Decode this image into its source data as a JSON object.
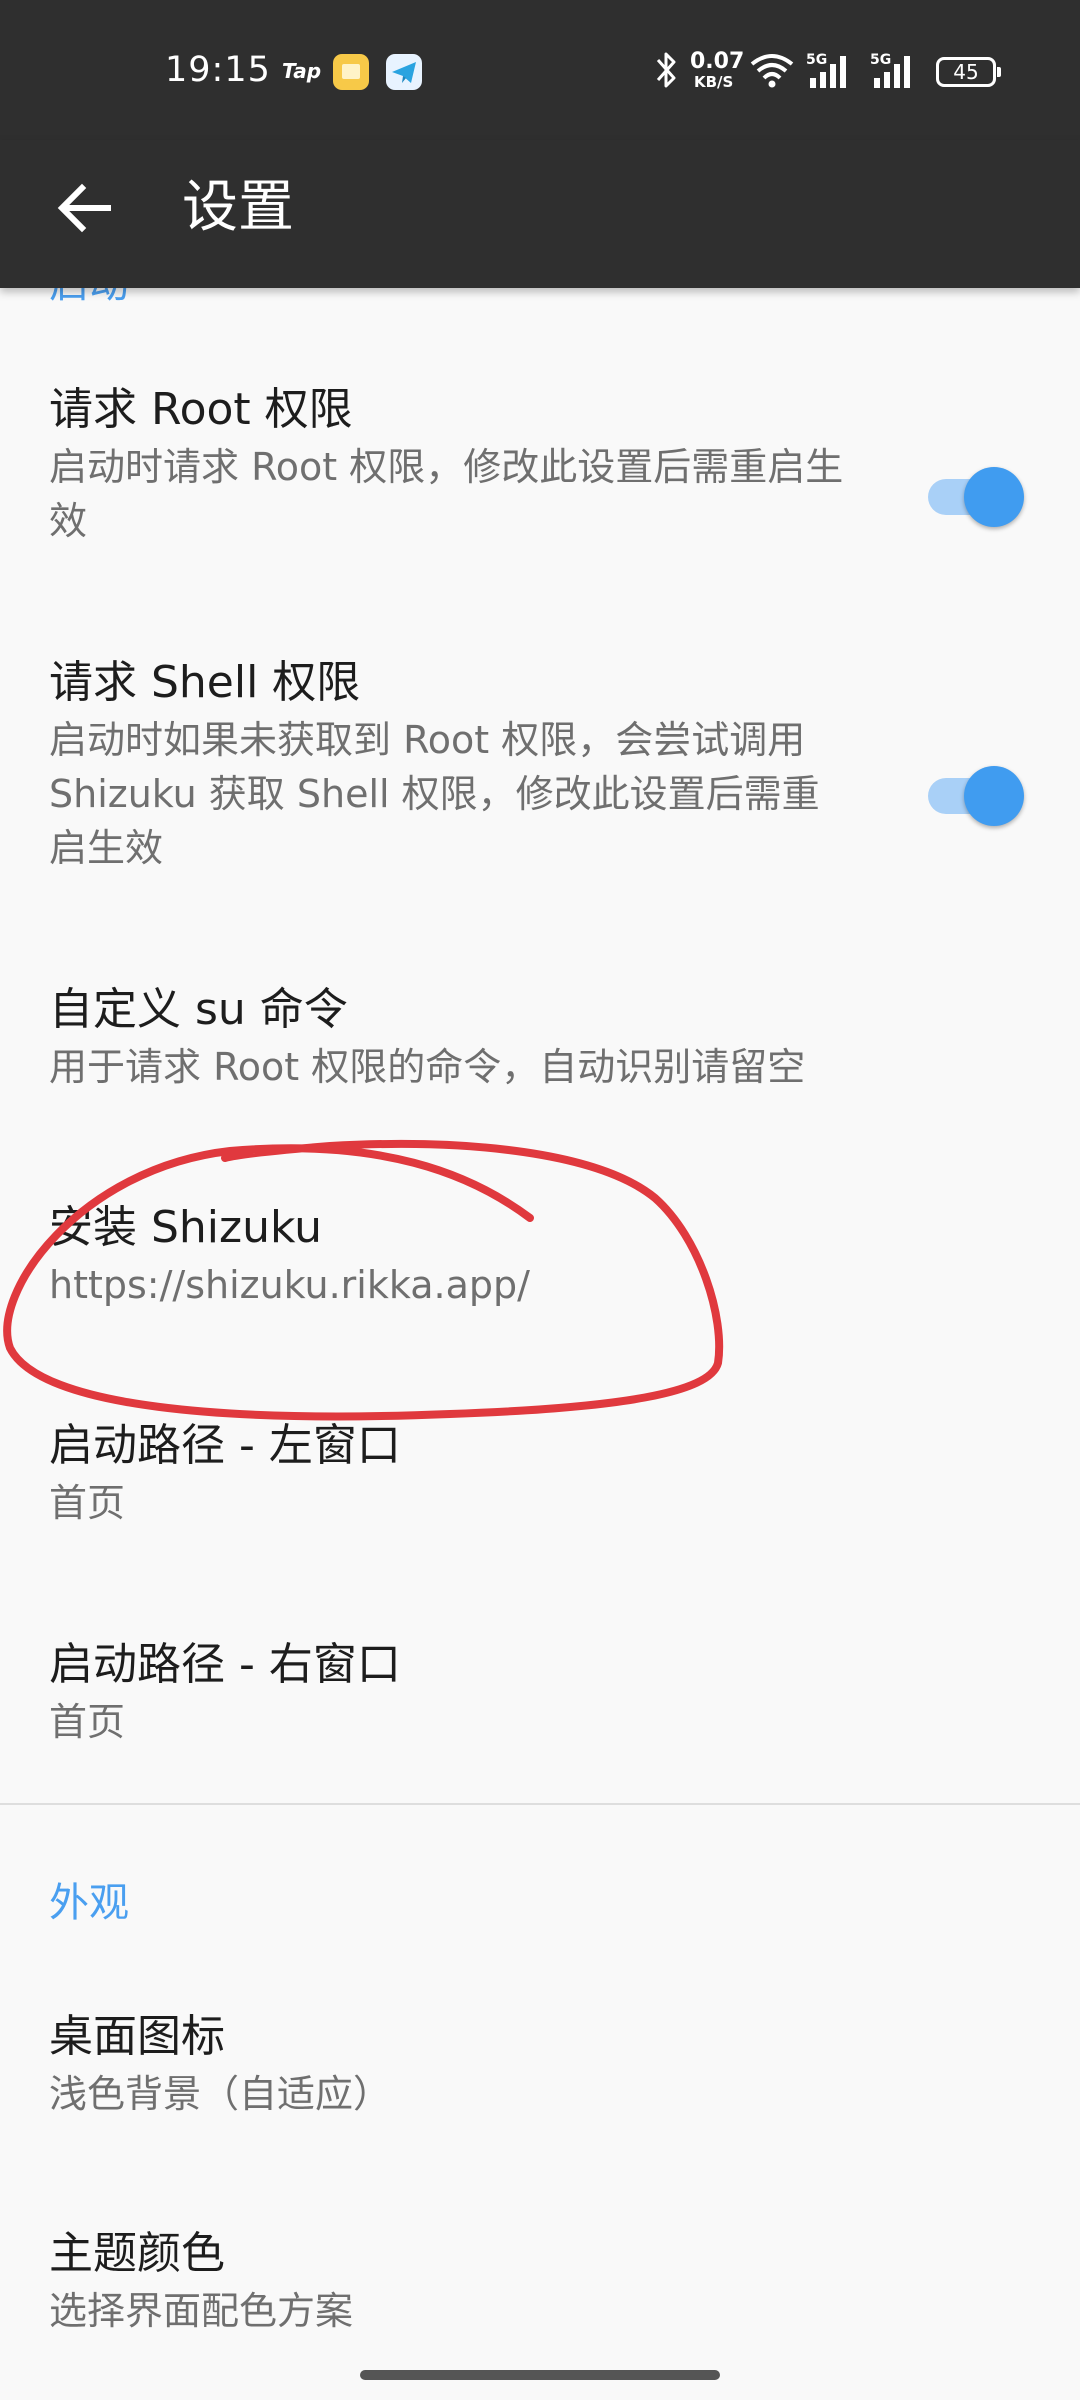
{
  "status_bar": {
    "time": "19:15",
    "app_badge_text": "Tap",
    "net_speed_value": "0.07",
    "net_speed_unit": "KB/S",
    "network_label_1": "5G",
    "network_label_2": "5G",
    "battery_level": "45",
    "icons": [
      "taptap-icon",
      "book-icon",
      "telegram-icon",
      "bluetooth-icon",
      "wifi-icon",
      "signal-icon",
      "battery-icon"
    ]
  },
  "toolbar": {
    "back_icon": "back-arrow-icon",
    "title": "设置"
  },
  "sections": {
    "startup_partial_title": "启动",
    "appearance_title": "外观"
  },
  "items": {
    "request_root": {
      "title": "请求 Root 权限",
      "summary": "启动时请求 Root 权限，修改此设置后需重启生效",
      "enabled": true
    },
    "request_shell": {
      "title": "请求 Shell 权限",
      "summary": "启动时如果未获取到 Root 权限，会尝试调用 Shizuku 获取 Shell 权限，修改此设置后需重启生效",
      "enabled": true
    },
    "custom_su": {
      "title": "自定义 su 命令",
      "summary": "用于请求 Root 权限的命令，自动识别请留空"
    },
    "install_shizuku": {
      "title": "安装 Shizuku",
      "summary": "https://shizuku.rikka.app/"
    },
    "launch_left": {
      "title": "启动路径 - 左窗口",
      "summary": "首页"
    },
    "launch_right": {
      "title": "启动路径 - 右窗口",
      "summary": "首页"
    },
    "desktop_icon": {
      "title": "桌面图标",
      "summary": "浅色背景（自适应）"
    },
    "theme_color": {
      "title": "主题颜色",
      "summary": "选择界面配色方案"
    }
  },
  "colors": {
    "app_bar": "#2f2f2f",
    "accent": "#409cf0",
    "switch_track": "#a9d0f7",
    "annotation_stroke": "#e0393e",
    "background": "#f9f9f9"
  }
}
